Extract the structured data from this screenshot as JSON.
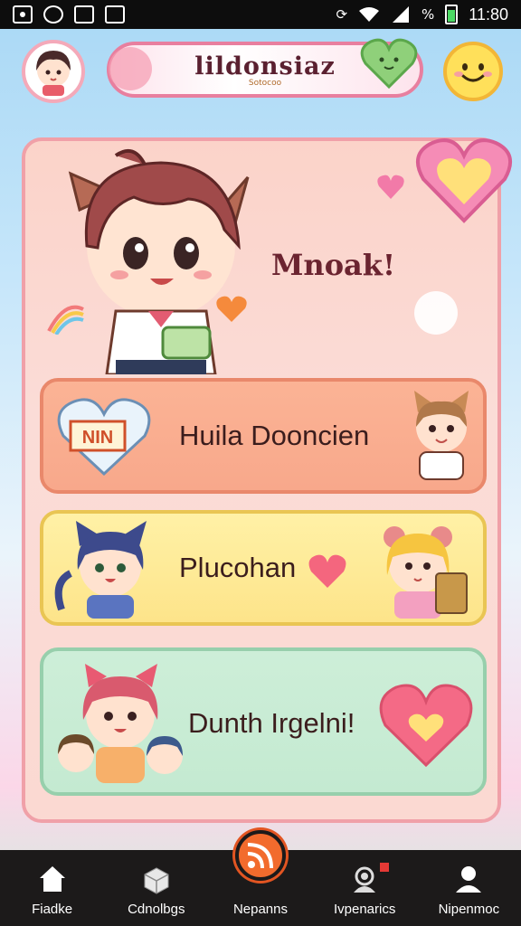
{
  "status_bar": {
    "time": "11:80",
    "battery_label": "%",
    "icons": [
      "image-icon",
      "sync-icon",
      "lock-icon",
      "check-clipboard-icon",
      "vibrate-icon",
      "wifi-icon",
      "signal-icon",
      "battery-icon"
    ]
  },
  "header": {
    "title": "lildonsiaz",
    "subtitle": "Sotocoo"
  },
  "hero": {
    "greeting": "Mnoak!"
  },
  "rows": [
    {
      "label": "Huila Dooncien",
      "badge_text": "NIN"
    },
    {
      "label": "Plucohan"
    },
    {
      "label": "Dunth Irgelni!"
    }
  ],
  "nav": {
    "items": [
      {
        "label": "Fiadke",
        "icon": "home-icon"
      },
      {
        "label": "Cdnolbgs",
        "icon": "box-icon"
      },
      {
        "label": "Nepanns",
        "icon": "rss-icon"
      },
      {
        "label": "Ivpenarics",
        "icon": "support-icon"
      },
      {
        "label": "Nipenmoc",
        "icon": "profile-icon"
      }
    ]
  },
  "colors": {
    "accent_orange": "#f26b2d",
    "card_border": "#f0a0a8",
    "row1": "#f8a88b",
    "row2": "#fde48a",
    "row3": "#c4ead1"
  }
}
